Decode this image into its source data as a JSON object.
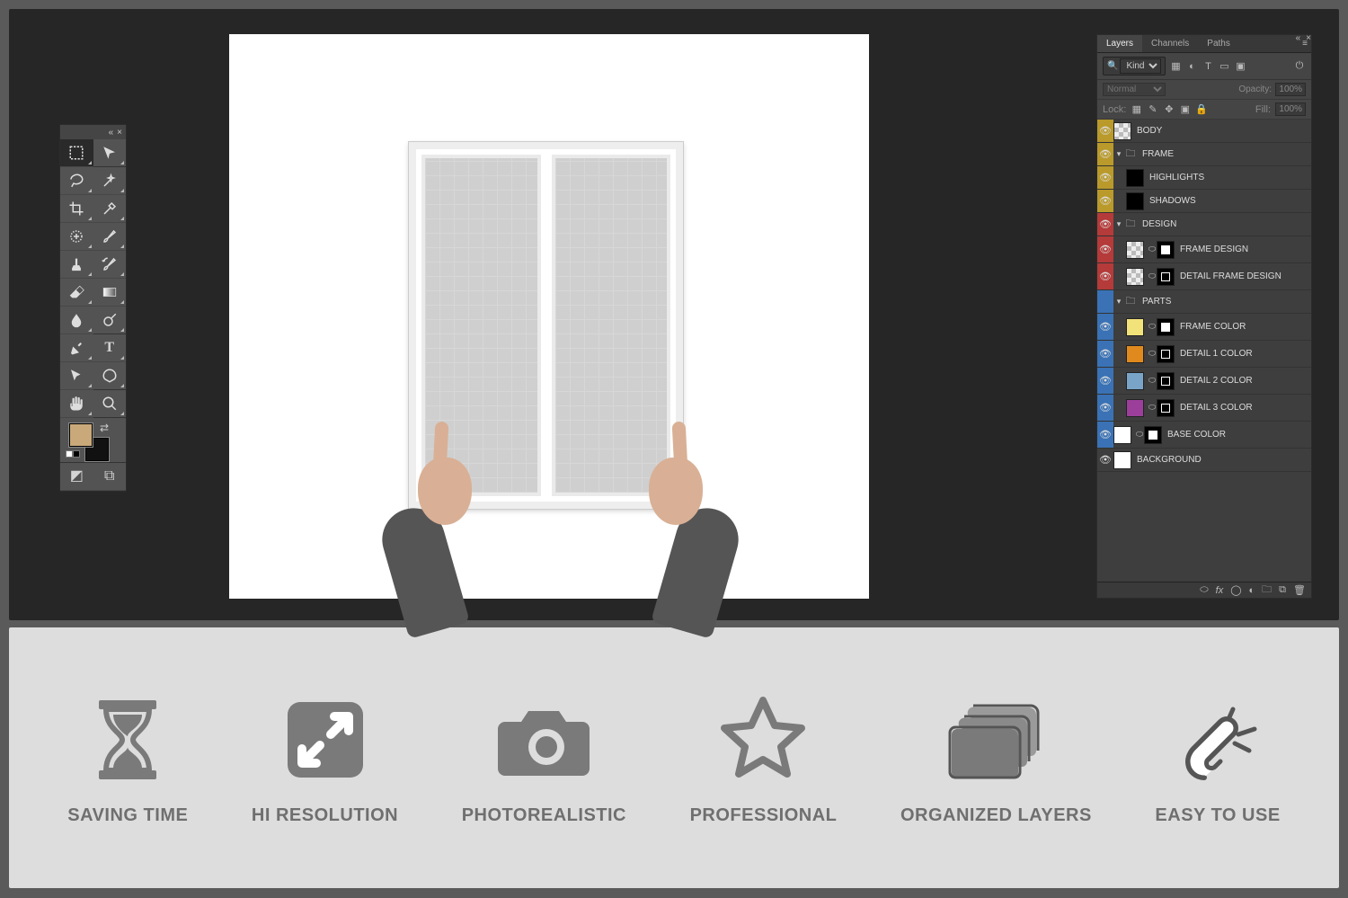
{
  "panel": {
    "tabs": [
      "Layers",
      "Channels",
      "Paths"
    ],
    "active_tab": 0,
    "filter_kind": "Kind",
    "blend_mode": "Normal",
    "opacity_label": "Opacity:",
    "opacity_value": "100%",
    "lock_label": "Lock:",
    "fill_label": "Fill:",
    "fill_value": "100%"
  },
  "layers": [
    {
      "color": "yellow",
      "depth": 0,
      "type": "layer",
      "name": "BODY",
      "vis": true,
      "thumbs": [
        "empty"
      ]
    },
    {
      "color": "yellow",
      "depth": 0,
      "type": "group",
      "name": "FRAME",
      "vis": true,
      "open": true
    },
    {
      "color": "yellow",
      "depth": 1,
      "type": "layer",
      "name": "HIGHLIGHTS",
      "vis": true,
      "thumbs": [
        "dark"
      ]
    },
    {
      "color": "yellow",
      "depth": 1,
      "type": "layer",
      "name": "SHADOWS",
      "vis": true,
      "thumbs": [
        "dark"
      ]
    },
    {
      "color": "red",
      "depth": 0,
      "type": "group",
      "name": "DESIGN",
      "vis": true,
      "open": true
    },
    {
      "color": "red",
      "depth": 1,
      "type": "layer",
      "name": "FRAME DESIGN",
      "vis": true,
      "thumbs": [
        "empty",
        "link",
        "white-rect"
      ]
    },
    {
      "color": "red",
      "depth": 1,
      "type": "layer",
      "name": "DETAIL FRAME DESIGN",
      "vis": true,
      "thumbs": [
        "empty",
        "link",
        "dark-border"
      ]
    },
    {
      "color": "blue",
      "depth": 0,
      "type": "group",
      "name": "PARTS",
      "vis": false,
      "open": true
    },
    {
      "color": "blue",
      "depth": 1,
      "type": "layer",
      "name": "FRAME COLOR",
      "vis": true,
      "thumbs": [
        "swatch:#f1e27a",
        "link",
        "white-rect"
      ]
    },
    {
      "color": "blue",
      "depth": 1,
      "type": "layer",
      "name": "DETAIL 1 COLOR",
      "vis": true,
      "thumbs": [
        "swatch:#e08a1e",
        "link",
        "dark-border"
      ]
    },
    {
      "color": "blue",
      "depth": 1,
      "type": "layer",
      "name": "DETAIL 2 COLOR",
      "vis": true,
      "thumbs": [
        "swatch:#7aa4c7",
        "link",
        "dark-border"
      ]
    },
    {
      "color": "blue",
      "depth": 1,
      "type": "layer",
      "name": "DETAIL 3 COLOR",
      "vis": true,
      "thumbs": [
        "swatch:#9b3f9b",
        "link",
        "dark-border"
      ]
    },
    {
      "color": "blue",
      "depth": 0,
      "type": "layer",
      "name": "BASE COLOR",
      "vis": true,
      "thumbs": [
        "swatch:#ffffff",
        "link",
        "white-rect"
      ]
    },
    {
      "color": "none",
      "depth": 0,
      "type": "layer",
      "name": "BACKGROUND",
      "vis": true,
      "thumbs": [
        "swatch:#ffffff"
      ]
    }
  ],
  "tools": [
    {
      "name": "marquee",
      "sel": true
    },
    {
      "name": "move"
    },
    {
      "name": "lasso"
    },
    {
      "name": "magic-wand"
    },
    {
      "name": "crop"
    },
    {
      "name": "eyedropper"
    },
    {
      "name": "patch"
    },
    {
      "name": "brush"
    },
    {
      "name": "clone-stamp"
    },
    {
      "name": "history-brush"
    },
    {
      "name": "eraser"
    },
    {
      "name": "gradient"
    },
    {
      "name": "blur"
    },
    {
      "name": "dodge"
    },
    {
      "name": "pen"
    },
    {
      "name": "type"
    },
    {
      "name": "path-select"
    },
    {
      "name": "shape"
    },
    {
      "name": "hand"
    },
    {
      "name": "zoom"
    }
  ],
  "features": [
    {
      "label": "SAVING TIME",
      "icon": "hourglass"
    },
    {
      "label": "HI RESOLUTION",
      "icon": "expand"
    },
    {
      "label": "PHOTOREALISTIC",
      "icon": "camera"
    },
    {
      "label": "PROFESSIONAL",
      "icon": "star"
    },
    {
      "label": "ORGANIZED LAYERS",
      "icon": "stack"
    },
    {
      "label": "EASY TO USE",
      "icon": "snap"
    }
  ]
}
